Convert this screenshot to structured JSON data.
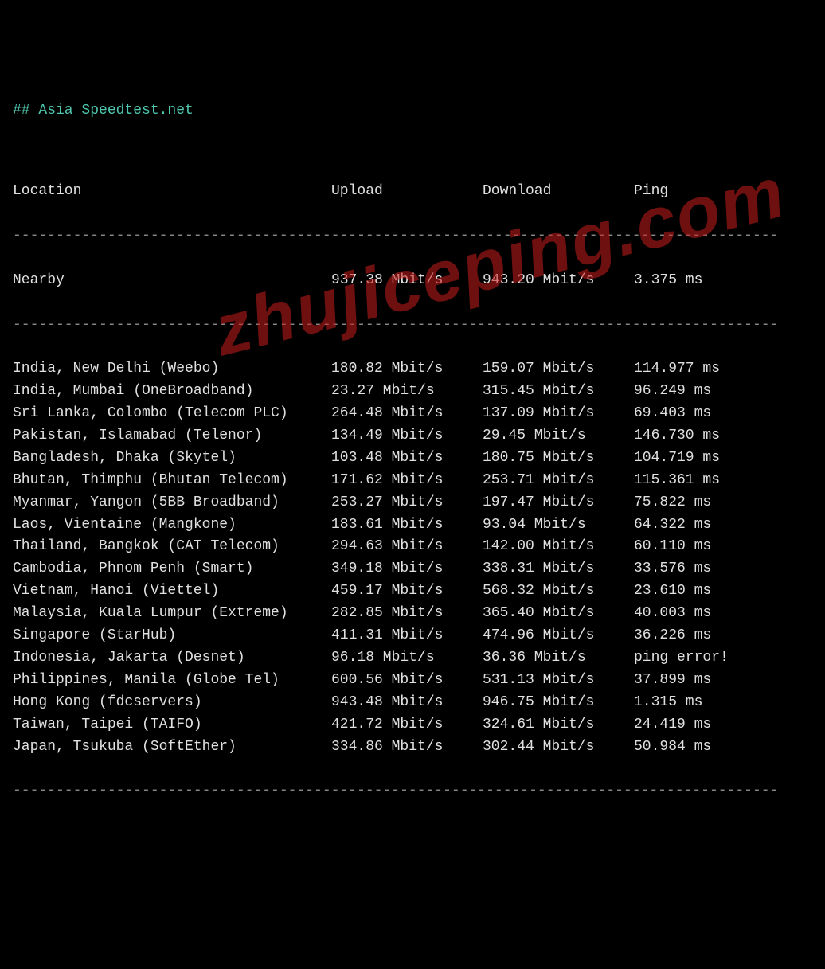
{
  "title": "## Asia Speedtest.net",
  "headers": {
    "location": "Location",
    "upload": "Upload",
    "download": "Download",
    "ping": "Ping"
  },
  "nearby": {
    "location": "Nearby",
    "upload": "937.38 Mbit/s",
    "download": "943.20 Mbit/s",
    "ping": "3.375 ms"
  },
  "rows": [
    {
      "location": "India, New Delhi (Weebo)",
      "upload": "180.82 Mbit/s",
      "download": "159.07 Mbit/s",
      "ping": "114.977 ms"
    },
    {
      "location": "India, Mumbai (OneBroadband)",
      "upload": "23.27 Mbit/s",
      "download": "315.45 Mbit/s",
      "ping": "96.249 ms"
    },
    {
      "location": "Sri Lanka, Colombo (Telecom PLC)",
      "upload": "264.48 Mbit/s",
      "download": "137.09 Mbit/s",
      "ping": "69.403 ms"
    },
    {
      "location": "Pakistan, Islamabad (Telenor)",
      "upload": "134.49 Mbit/s",
      "download": "29.45 Mbit/s",
      "ping": "146.730 ms"
    },
    {
      "location": "Bangladesh, Dhaka (Skytel)",
      "upload": "103.48 Mbit/s",
      "download": "180.75 Mbit/s",
      "ping": "104.719 ms"
    },
    {
      "location": "Bhutan, Thimphu (Bhutan Telecom)",
      "upload": "171.62 Mbit/s",
      "download": "253.71 Mbit/s",
      "ping": "115.361 ms"
    },
    {
      "location": "Myanmar, Yangon (5BB Broadband)",
      "upload": "253.27 Mbit/s",
      "download": "197.47 Mbit/s",
      "ping": "75.822 ms"
    },
    {
      "location": "Laos, Vientaine (Mangkone)",
      "upload": "183.61 Mbit/s",
      "download": "93.04 Mbit/s",
      "ping": "64.322 ms"
    },
    {
      "location": "Thailand, Bangkok (CAT Telecom)",
      "upload": "294.63 Mbit/s",
      "download": "142.00 Mbit/s",
      "ping": "60.110 ms"
    },
    {
      "location": "Cambodia, Phnom Penh (Smart)",
      "upload": "349.18 Mbit/s",
      "download": "338.31 Mbit/s",
      "ping": "33.576 ms"
    },
    {
      "location": "Vietnam, Hanoi (Viettel)",
      "upload": "459.17 Mbit/s",
      "download": "568.32 Mbit/s",
      "ping": "23.610 ms"
    },
    {
      "location": "Malaysia, Kuala Lumpur (Extreme)",
      "upload": "282.85 Mbit/s",
      "download": "365.40 Mbit/s",
      "ping": "40.003 ms"
    },
    {
      "location": "Singapore (StarHub)",
      "upload": "411.31 Mbit/s",
      "download": "474.96 Mbit/s",
      "ping": "36.226 ms"
    },
    {
      "location": "Indonesia, Jakarta (Desnet)",
      "upload": "96.18 Mbit/s",
      "download": "36.36 Mbit/s",
      "ping": "ping error!"
    },
    {
      "location": "Philippines, Manila (Globe Tel)",
      "upload": "600.56 Mbit/s",
      "download": "531.13 Mbit/s",
      "ping": "37.899 ms"
    },
    {
      "location": "Hong Kong (fdcservers)",
      "upload": "943.48 Mbit/s",
      "download": "946.75 Mbit/s",
      "ping": "1.315 ms"
    },
    {
      "location": "Taiwan, Taipei (TAIFO)",
      "upload": "421.72 Mbit/s",
      "download": "324.61 Mbit/s",
      "ping": "24.419 ms"
    },
    {
      "location": "Japan, Tsukuba (SoftEther)",
      "upload": "334.86 Mbit/s",
      "download": "302.44 Mbit/s",
      "ping": "50.984 ms"
    }
  ],
  "divider": "-----------------------------------------------------------------------------------------",
  "watermark": "zhujiceping.com"
}
